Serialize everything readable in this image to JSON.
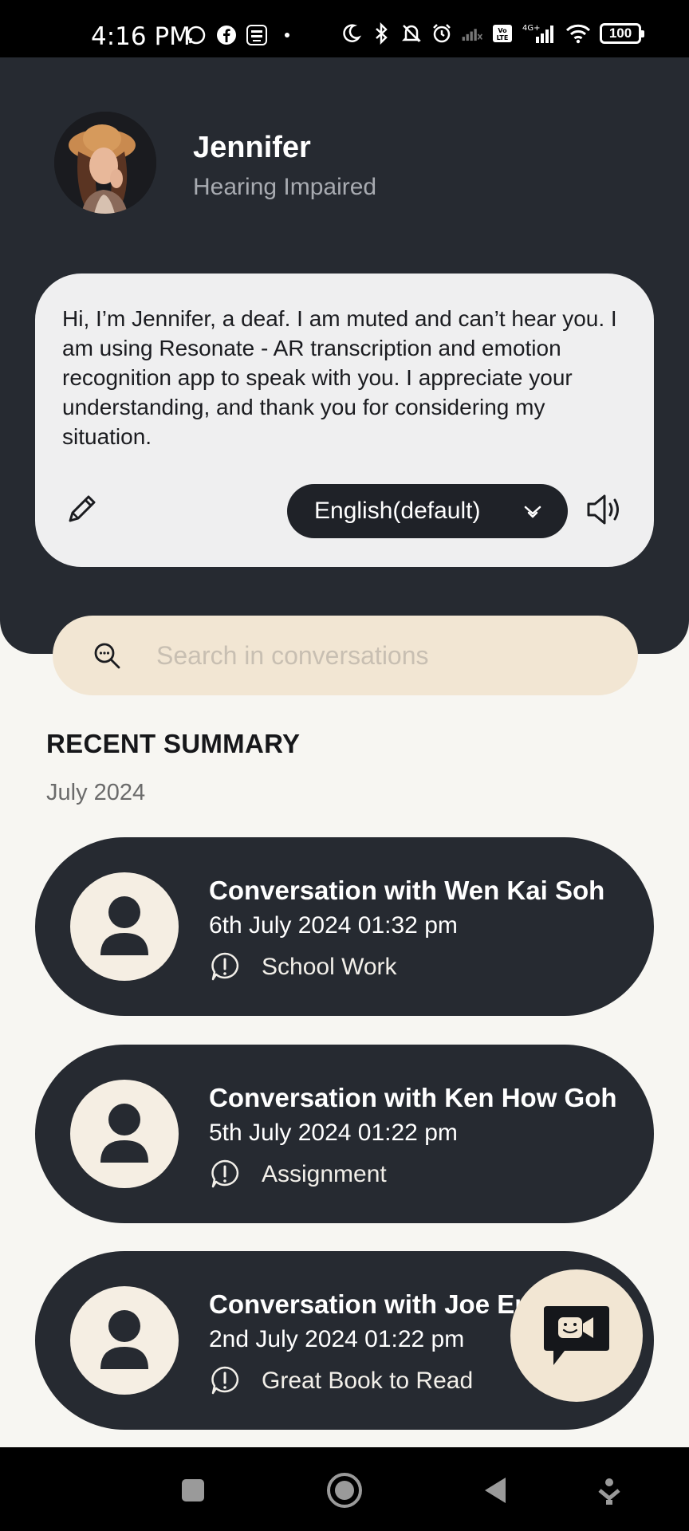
{
  "status_bar": {
    "time": "4:16 PM",
    "battery": "100",
    "left_icons": [
      "whatsapp-icon",
      "facebook-icon",
      "touch-n-go-icon",
      "dot-icon"
    ],
    "right_icons": [
      "moon-icon",
      "bluetooth-icon",
      "bell-off-icon",
      "alarm-icon",
      "signal-icon",
      "volte-icon",
      "signal-4g-icon",
      "wifi-icon"
    ]
  },
  "profile": {
    "name": "Jennifer",
    "role": "Hearing Impaired"
  },
  "intro": {
    "message": "Hi, I’m Jennifer, a deaf. I am muted and can’t hear you. I am using Resonate - AR transcription and emotion recognition app to speak with you. I appreciate your understanding, and thank you for considering my situation.",
    "language": "English(default)"
  },
  "search": {
    "placeholder": "Search in conversations"
  },
  "recent": {
    "title": "RECENT SUMMARY",
    "month": "July 2024",
    "conversations": [
      {
        "title": "Conversation with Wen Kai Soh",
        "date": "6th July 2024 01:32 pm",
        "tag": "School Work"
      },
      {
        "title": "Conversation with Ken How Goh",
        "date": "5th July 2024 01:22 pm",
        "tag": "Assignment"
      },
      {
        "title": "Conversation with Joe Er",
        "date": "2nd July 2024 01:22 pm",
        "tag": "Great Book to Read"
      }
    ]
  },
  "colors": {
    "dark": "#262a31",
    "cream": "#f2e6d3",
    "background": "#f7f6f2",
    "card": "#efeff0"
  }
}
